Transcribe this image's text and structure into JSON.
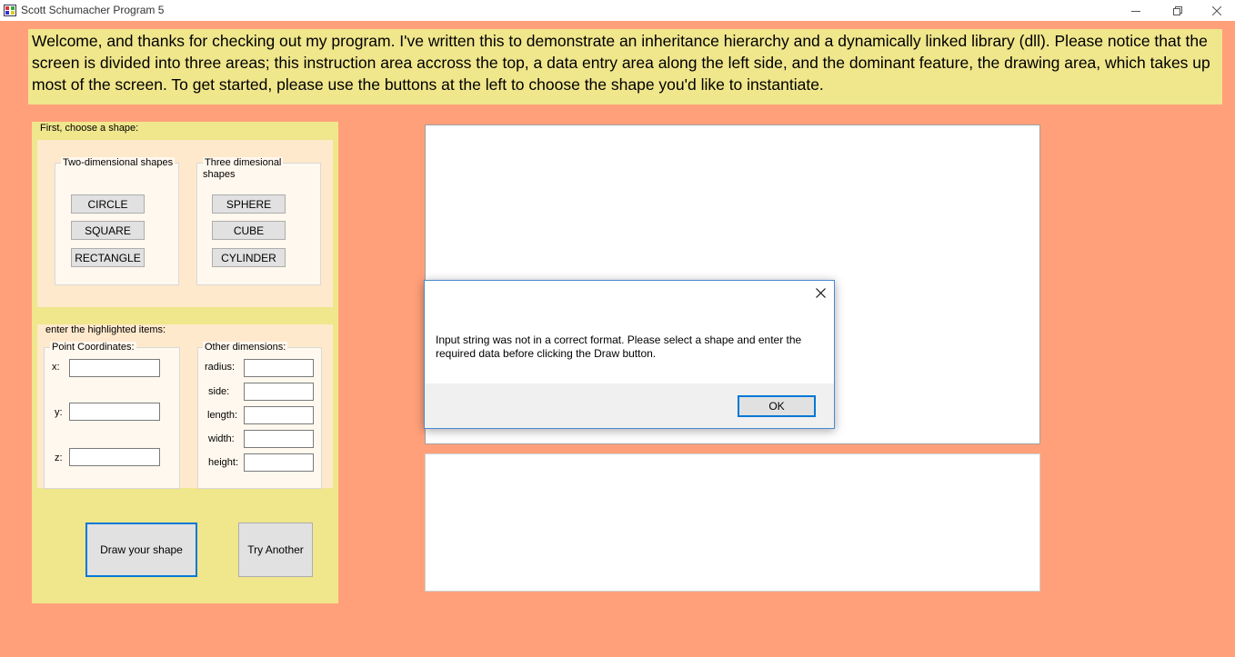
{
  "window": {
    "title": "Scott Schumacher Program 5",
    "minimize_icon": "minimize-icon",
    "maximize_icon": "restore-icon",
    "close_icon": "close-icon"
  },
  "instructions": "Welcome, and thanks for checking out my program. I've written this to demonstrate an inheritance hierarchy and a dynamically linked library (dll). Please notice that the screen is divided into three areas; this instruction area accross the top, a data entry area along the left side, and the dominant feature, the drawing area, which takes up most of the screen. To get started, please use the  buttons at the left to choose the shape you'd like to instantiate.",
  "shape_panel": {
    "heading": "First, choose a shape:",
    "two_d": {
      "label": "Two-dimensional shapes",
      "buttons": [
        "CIRCLE",
        "SQUARE",
        "RECTANGLE"
      ]
    },
    "three_d": {
      "label_line1": "Three dimesional",
      "label_line2": "shapes",
      "buttons": [
        "SPHERE",
        "CUBE",
        "CYLINDER"
      ]
    }
  },
  "entry_panel": {
    "heading": "enter the highlighted items:",
    "point": {
      "label": "Point Coordinates:",
      "fields": [
        {
          "label": "x:",
          "value": ""
        },
        {
          "label": "y:",
          "value": ""
        },
        {
          "label": "z:",
          "value": ""
        }
      ]
    },
    "other": {
      "label": "Other dimensions:",
      "fields": [
        {
          "label": "radius:",
          "value": ""
        },
        {
          "label": "side:",
          "value": ""
        },
        {
          "label": "length:",
          "value": ""
        },
        {
          "label": "width:",
          "value": ""
        },
        {
          "label": "height:",
          "value": ""
        }
      ]
    }
  },
  "actions": {
    "draw_label": "Draw your shape",
    "try_label": "Try Another"
  },
  "dialog": {
    "message_line1": "Input string was not in a correct format. Please select a shape  and enter the",
    "message_line2": "required data before clicking the Draw button.",
    "ok_label": "OK",
    "close_icon": "close-icon"
  },
  "colors": {
    "background": "#ffa07a",
    "panel": "#f0e68c",
    "accent": "#0078d7"
  }
}
